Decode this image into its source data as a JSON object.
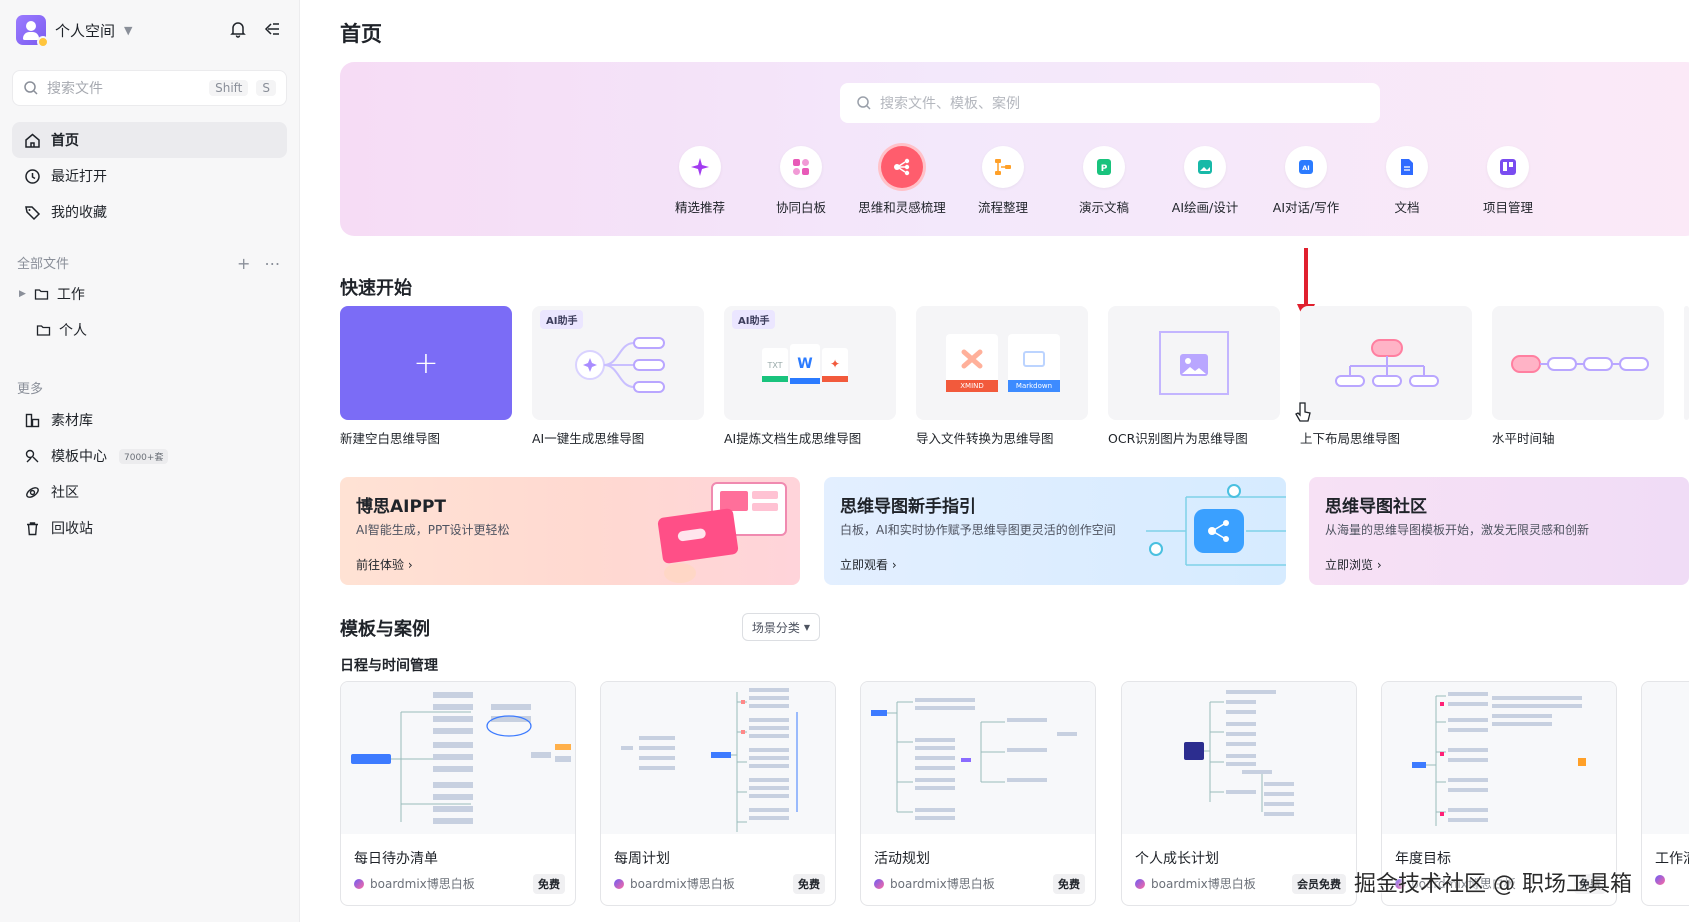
{
  "sidebar": {
    "workspace_name": "个人空间",
    "search": {
      "placeholder": "搜索文件",
      "shortcut1": "Shift",
      "shortcut2": "S"
    },
    "nav": [
      {
        "label": "首页",
        "icon": "home-icon",
        "active": true
      },
      {
        "label": "最近打开",
        "icon": "clock-icon"
      },
      {
        "label": "我的收藏",
        "icon": "tag-icon"
      }
    ],
    "all_files_label": "全部文件",
    "folders": [
      {
        "label": "工作",
        "icon": "folder-icon"
      },
      {
        "label": "个人",
        "icon": "folder-icon"
      }
    ],
    "more_label": "更多",
    "more": [
      {
        "label": "素材库",
        "icon": "material-icon"
      },
      {
        "label": "模板中心",
        "icon": "template-icon",
        "badge": "7000+套"
      },
      {
        "label": "社区",
        "icon": "community-icon"
      },
      {
        "label": "回收站",
        "icon": "trash-icon"
      }
    ]
  },
  "main": {
    "page_title": "首页",
    "hero": {
      "search_placeholder": "搜索文件、模板、案例",
      "categories": [
        {
          "label": "精选推荐",
          "icon": "sparkle-icon"
        },
        {
          "label": "协同白板",
          "icon": "whiteboard-icon"
        },
        {
          "label": "思维和灵感梳理",
          "icon": "mindmap-icon",
          "selected": true
        },
        {
          "label": "流程整理",
          "icon": "flowchart-icon"
        },
        {
          "label": "演示文稿",
          "icon": "presentation-icon"
        },
        {
          "label": "AI绘画/设计",
          "icon": "ai-image-icon"
        },
        {
          "label": "AI对话/写作",
          "icon": "ai-chat-icon"
        },
        {
          "label": "文档",
          "icon": "document-icon"
        },
        {
          "label": "项目管理",
          "icon": "project-icon"
        }
      ]
    },
    "quick_start": {
      "title": "快速开始",
      "ai_tag": "AI助手",
      "xmind": "XMIND",
      "markdown": "Markdown",
      "cards": [
        {
          "label": "新建空白思维导图"
        },
        {
          "label": "AI一键生成思维导图"
        },
        {
          "label": "AI提炼文档生成思维导图"
        },
        {
          "label": "导入文件转换为思维导图"
        },
        {
          "label": "OCR识别图片为思维导图"
        },
        {
          "label": "上下布局思维导图"
        },
        {
          "label": "水平时间轴"
        }
      ]
    },
    "banners": [
      {
        "title": "博思AIPPT",
        "subtitle": "AI智能生成，PPT设计更轻松",
        "link": "前往体验"
      },
      {
        "title": "思维导图新手指引",
        "subtitle": "白板，AI和实时协作赋予思维导图更灵活的创作空间",
        "link": "立即观看"
      },
      {
        "title": "思维导图社区",
        "subtitle": "从海量的思维导图模板开始，激发无限灵感和创新",
        "link": "立即浏览"
      }
    ],
    "templates": {
      "title": "模板与案例",
      "filter": "场景分类",
      "subtitle": "日程与时间管理",
      "source": "boardmix博思白板",
      "cards": [
        {
          "name": "每日待办清单",
          "price": "免费"
        },
        {
          "name": "每周计划",
          "price": "免费"
        },
        {
          "name": "活动规划",
          "price": "免费"
        },
        {
          "name": "个人成长计划",
          "price": "会员免费"
        },
        {
          "name": "年度目标",
          "price": "免费"
        },
        {
          "name": "工作清"
        }
      ]
    }
  },
  "watermark": "掘金技术社区 @ 职场工具箱",
  "colors": {
    "accent": "#7b6cf6",
    "selected_category": "#ff5d6d",
    "arrow": "#e0202e"
  }
}
